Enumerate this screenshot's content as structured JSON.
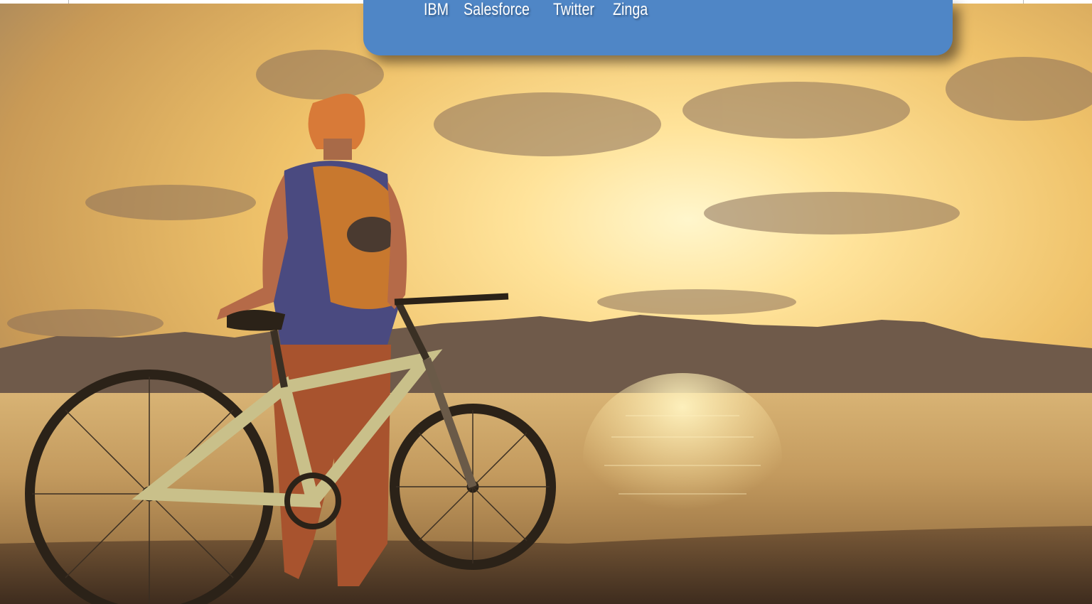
{
  "panel": {
    "links": [
      "IBM",
      "Salesforce",
      "Twitter",
      "Zinga"
    ]
  },
  "colors": {
    "panel_bg": "#4f86c6",
    "link_text": "#ffffff",
    "sky_glow": "#fff4c8",
    "water": "#c9a063"
  },
  "photo": {
    "icon": "sunset-cyclist-photo"
  }
}
